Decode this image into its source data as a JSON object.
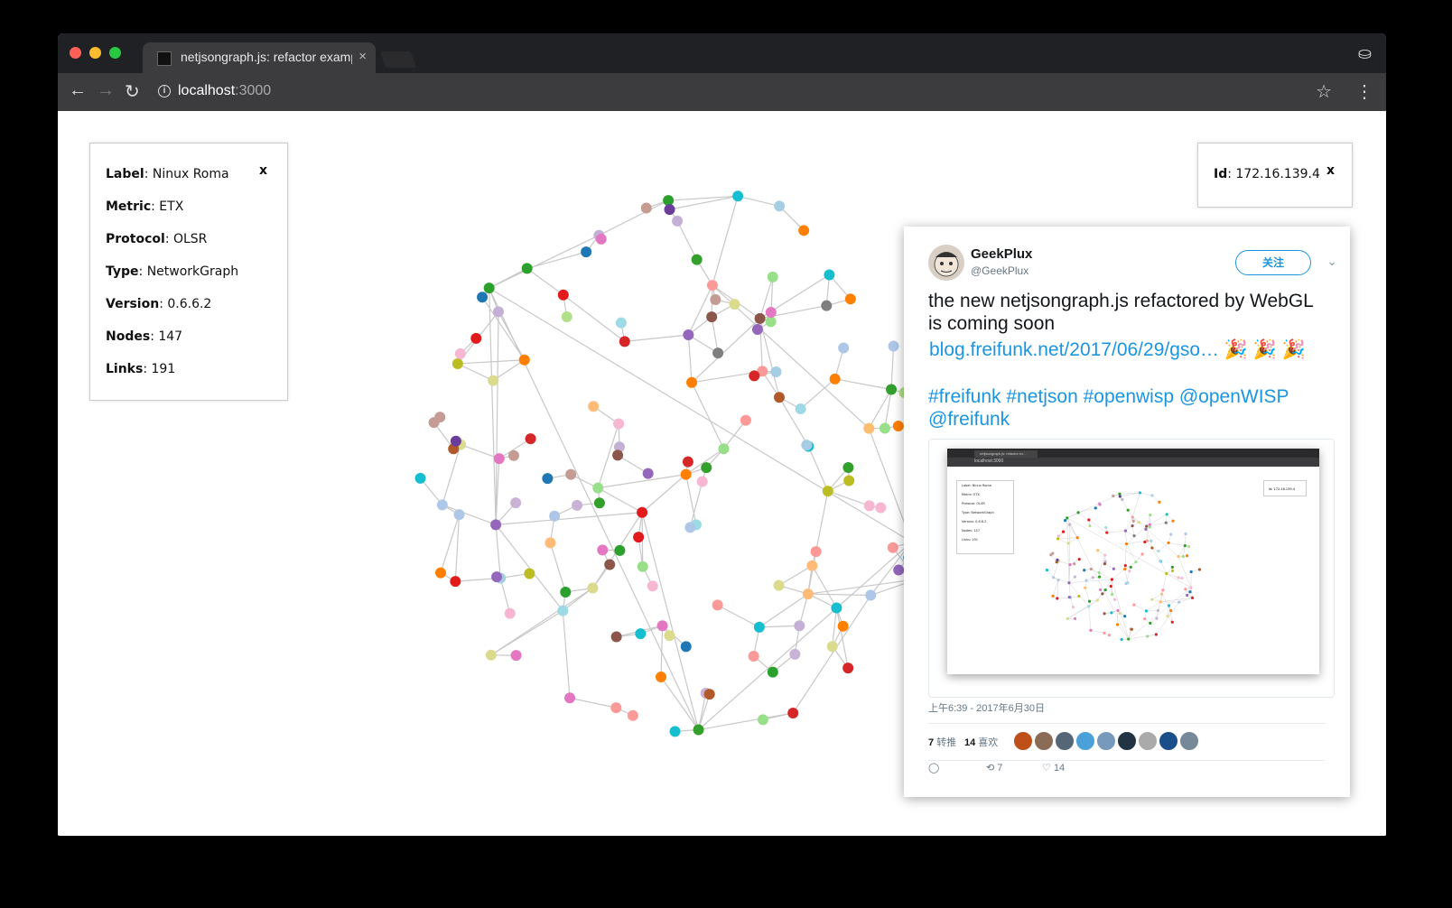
{
  "browser": {
    "tab_title": "netjsongraph.js: refactor example",
    "tab_close": "×",
    "url_host": "localhost",
    "url_port": ":3000",
    "back": "←",
    "forward": "→",
    "reload": "↻",
    "info": "i",
    "bookmark": "☆",
    "menu": "⋮",
    "incognito": "⛀",
    "traffic_colors": [
      "#ff5f57",
      "#febc2e",
      "#28c840"
    ]
  },
  "info_panel": {
    "close": "x",
    "rows": [
      {
        "key": "Label",
        "value": ": Ninux Roma"
      },
      {
        "key": "Metric",
        "value": ": ETX"
      },
      {
        "key": "Protocol",
        "value": ": OLSR"
      },
      {
        "key": "Type",
        "value": ": NetworkGraph"
      },
      {
        "key": "Version",
        "value": ": 0.6.6.2"
      },
      {
        "key": "Nodes",
        "value": ": 147"
      },
      {
        "key": "Links",
        "value": ": 191"
      }
    ]
  },
  "id_panel": {
    "key": "Id",
    "value": ": 172.16.139.4",
    "close": "x"
  },
  "tweet": {
    "name": "GeekPlux",
    "handle": "@GeekPlux",
    "follow": "关注",
    "chevron": "⌄",
    "text": "the new netjsongraph.js refactored by WebGL is coming soon",
    "link": "blog.freifunk.net/2017/06/29/gso… 🎉 🎉 🎉",
    "tags": "#freifunk #netjson #openwisp @openWISP @freifunk",
    "time": "上午6:39 - 2017年6月30日",
    "retweets_count": "7",
    "retweets_label": " 转推",
    "likes_count": "14",
    "likes_label": " 喜欢",
    "reply_icon": "◯",
    "retweet_icon": "⟲",
    "retweet_num": "7",
    "like_icon": "♡",
    "like_num": "14",
    "liker_colors": [
      "#c0501a",
      "#8a6b55",
      "#556677",
      "#4aa0d8",
      "#7799bb",
      "#223344",
      "#aaaaaa",
      "#1b4f8a",
      "#778899"
    ],
    "mini": {
      "tab": "netjsongraph.js: refactor ex...",
      "url": "localhost:3000",
      "rows": [
        "Label: Ninux Roma",
        "Metric: ETX",
        "Protocol: OLSR",
        "Type: NetworkGraph",
        "Version: 0.6.6.2",
        "Nodes: 147",
        "Links: 191"
      ],
      "id": "Id: 172.16.139.4"
    }
  },
  "graph": {
    "node_colors": [
      "#e31a1c",
      "#1f78b4",
      "#33a02c",
      "#ff7f00",
      "#6a3d9a",
      "#b15928",
      "#a6cee3",
      "#b2df8a",
      "#fb9a99",
      "#fdbf6f",
      "#cab2d6",
      "#17becf",
      "#bcbd22",
      "#7f7f7f",
      "#e377c2",
      "#c49c94",
      "#9edae5",
      "#f7b6d2",
      "#aec7e8",
      "#ffbb78",
      "#98df8a",
      "#ff9896",
      "#c5b0d5",
      "#8c564b",
      "#9467bd",
      "#dbdb8d",
      "#2ca02c",
      "#d62728"
    ],
    "link_color": "#c8c8c8"
  }
}
